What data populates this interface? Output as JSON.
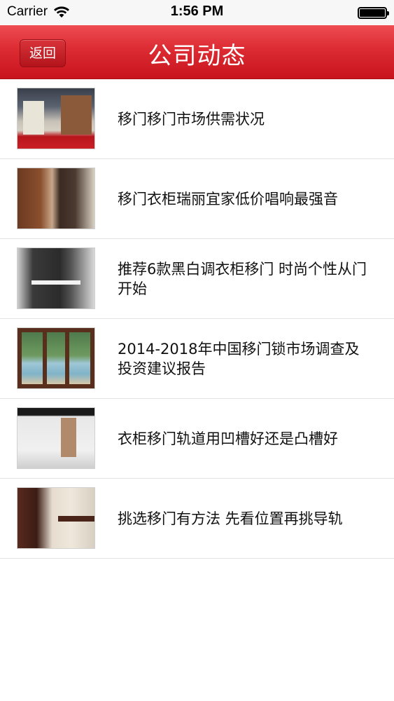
{
  "status_bar": {
    "carrier": "Carrier",
    "time": "1:56 PM",
    "battery_level": 1.0
  },
  "nav": {
    "back_label": "返回",
    "title": "公司动态"
  },
  "articles": [
    {
      "title": "移门移门市场供需状况",
      "thumb": "trade-show-booth"
    },
    {
      "title": "移门衣柜瑞丽宜家低价唱响最强音",
      "thumb": "wooden-wardrobe"
    },
    {
      "title": "推荐6款黑白调衣柜移门 时尚个性从门开始",
      "thumb": "black-white-wardrobe"
    },
    {
      "title": "2014-2018年中国移门锁市场调查及投资建议报告",
      "thumb": "glass-sliding-door"
    },
    {
      "title": "衣柜移门轨道用凹槽好还是凸槽好",
      "thumb": "white-wardrobe"
    },
    {
      "title": "挑选移门有方法 先看位置再挑导轨",
      "thumb": "sliding-door-room"
    }
  ],
  "colors": {
    "nav_red": "#dc2b33",
    "divider": "#e3e3e3"
  }
}
